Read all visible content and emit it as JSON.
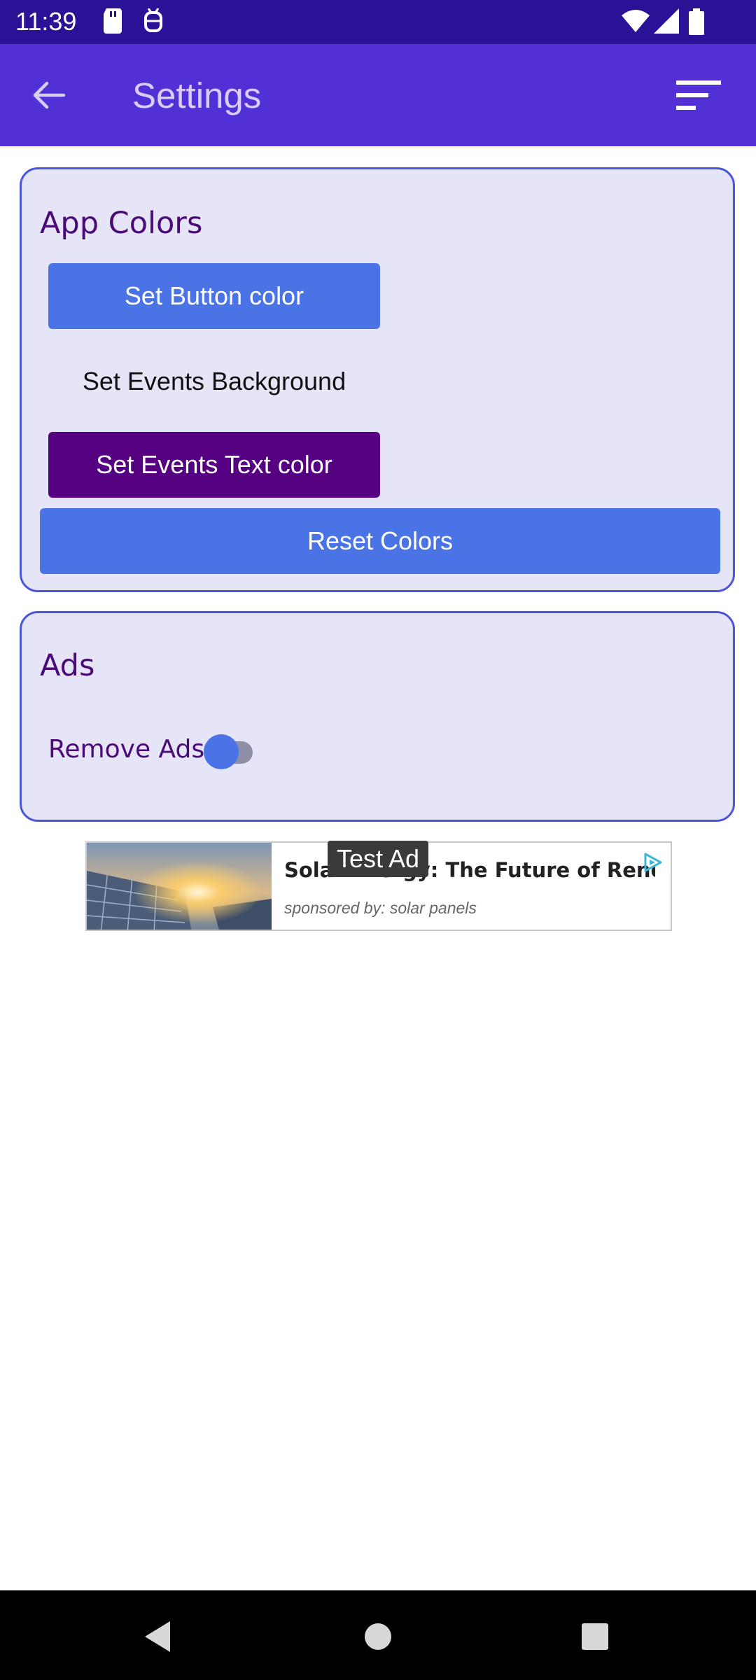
{
  "status_bar": {
    "time": "11:39",
    "left_icons": [
      "sd-card-icon",
      "debug-icon"
    ],
    "right_icons": [
      "wifi-icon",
      "signal-icon",
      "battery-icon"
    ]
  },
  "app_bar": {
    "title": "Settings",
    "back_icon": "arrow-left-icon",
    "menu_icon": "sort-icon"
  },
  "app_colors": {
    "title": "App Colors",
    "set_button_color": "Set Button color",
    "set_events_background": "Set Events Background",
    "set_events_text_color": "Set Events Text color",
    "reset_colors": "Reset Colors"
  },
  "ads": {
    "title": "Ads",
    "remove_ads_label": "Remove Ads",
    "remove_ads_enabled": true
  },
  "ad_banner": {
    "headline": "Solar Energy: The Future of Renewab…",
    "sponsor": "sponsored by: solar panels",
    "badge": "Test Ad",
    "choices_icon": "ad-choices-icon"
  },
  "nav_bar": {
    "icons": [
      "back-triangle-icon",
      "home-circle-icon",
      "recents-square-icon"
    ]
  },
  "colors": {
    "status_bar": "#2a1195",
    "app_bar": "#5330d6",
    "button_blue": "#4a73e6",
    "button_purple": "#560082",
    "card_bg": "#e6e5f8",
    "card_border": "#4a56d8",
    "title_purple": "#4a0a78"
  }
}
